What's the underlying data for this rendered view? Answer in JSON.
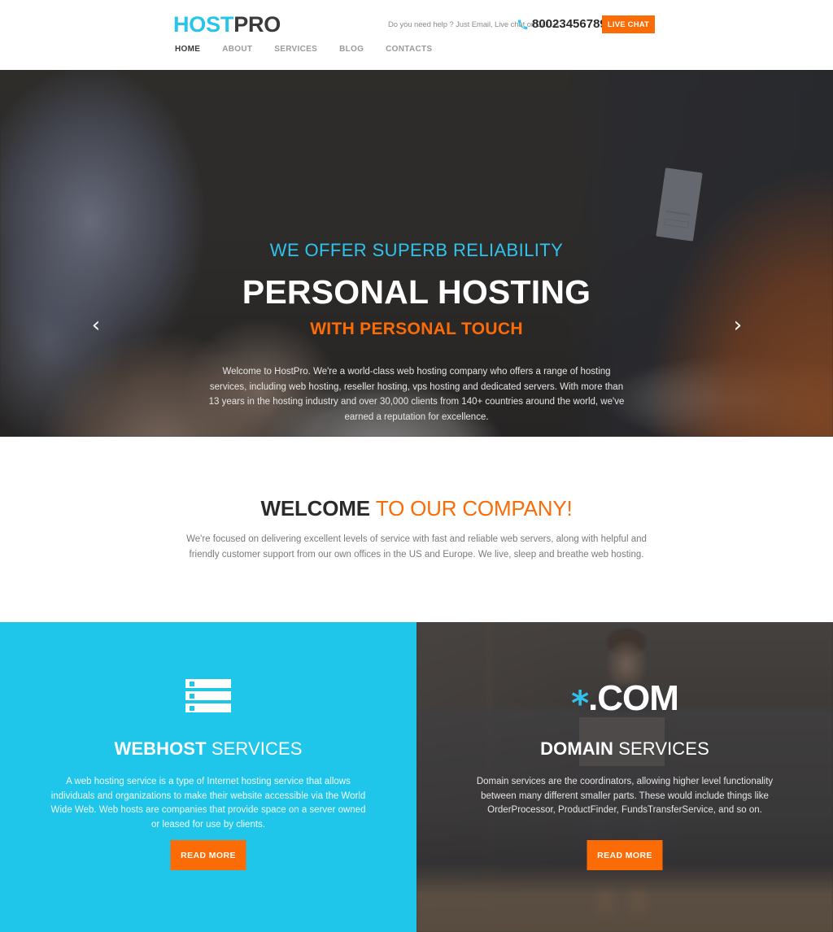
{
  "header": {
    "logo": {
      "part1": "HOST",
      "part2": "PRO"
    },
    "help_text": "Do you need help ? Just Email, Live chat or Call us",
    "phone_icon": "phone-icon",
    "phone": "80023456789",
    "live_chat_label": "LIVE CHAT",
    "nav": [
      {
        "label": "HOME",
        "active": true
      },
      {
        "label": "ABOUT",
        "active": false
      },
      {
        "label": "SERVICES",
        "active": false
      },
      {
        "label": "BLOG",
        "active": false
      },
      {
        "label": "CONTACTS",
        "active": false
      }
    ]
  },
  "hero": {
    "kicker": "WE OFFER SUPERB RELIABILITY",
    "title": "PERSONAL HOSTING",
    "subtitle": "WITH PERSONAL TOUCH",
    "description": "Welcome to HostPro. We're a world-class web hosting company who offers a range of hosting services, including web hosting, reseller hosting, vps hosting and dedicated servers. With more than 13 years in the hosting industry and over 30,000 clients from 140+ countries around the world, we've earned a reputation for excellence.",
    "prev_arrow": "‹",
    "next_arrow": "›"
  },
  "welcome": {
    "title_bold": "WELCOME",
    "title_accent": "TO OUR COMPANY!",
    "description": "We're focused on delivering excellent levels of service with fast and reliable web servers, along with helpful and friendly customer support from our own offices in the US and Europe. We live, sleep and breathe web hosting."
  },
  "services": {
    "webhost": {
      "icon": "server-icon",
      "title_bold": "WEBHOST",
      "title_normal": "SERVICES",
      "description": "A web hosting service is a type of Internet hosting service that allows individuals and organizations to make their website accessible via the World Wide Web. Web hosts are companies that provide space on a server owned or leased for use by clients.",
      "button_label": "READ MORE"
    },
    "domain": {
      "icon_asterisk": "*",
      "icon_text": ".COM",
      "title_bold": "DOMAIN",
      "title_normal": "SERVICES",
      "description": "Domain services are the coordinators, allowing higher level functionality between many different smaller parts.  These would include things like OrderProcessor, ProductFinder, FundsTransferService, and so on.",
      "button_label": "READ MORE"
    }
  },
  "colors": {
    "cyan": "#1FC6EA",
    "orange": "#FB6B06",
    "dark": "#2b2b2b",
    "muted": "#9a9a9a"
  }
}
